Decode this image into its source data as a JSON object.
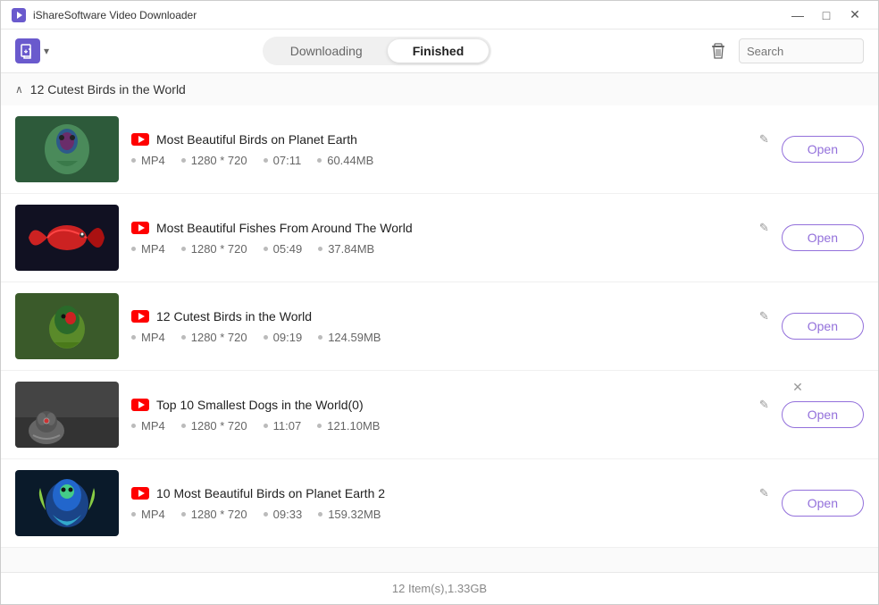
{
  "titleBar": {
    "title": "iShareSoftware Video Downloader",
    "controls": {
      "minimize": "—",
      "maximize": "□",
      "close": "✕"
    }
  },
  "toolbar": {
    "addIcon": "⬇",
    "chevron": "▾",
    "tabs": [
      {
        "id": "downloading",
        "label": "Downloading",
        "active": false
      },
      {
        "id": "finished",
        "label": "Finished",
        "active": true
      }
    ],
    "deleteIcon": "🗑",
    "searchPlaceholder": "Search"
  },
  "groupHeader": {
    "title": "12 Cutest Birds in the World",
    "collapseIcon": "∧"
  },
  "videos": [
    {
      "id": 1,
      "title": "Most Beautiful Birds on Planet Earth",
      "format": "MP4",
      "resolution": "1280 * 720",
      "duration": "07:11",
      "size": "60.44MB",
      "showClose": false,
      "thumbColors": [
        "#3a7a5a",
        "#6abf8a",
        "#8b3a5a",
        "#c04a6a"
      ]
    },
    {
      "id": 2,
      "title": "Most Beautiful Fishes From Around The World",
      "format": "MP4",
      "resolution": "1280 * 720",
      "duration": "05:49",
      "size": "37.84MB",
      "showClose": false,
      "thumbColors": [
        "#cc2222",
        "#ff4444",
        "#222244",
        "#112233"
      ]
    },
    {
      "id": 3,
      "title": "12 Cutest Birds in the World",
      "format": "MP4",
      "resolution": "1280 * 720",
      "duration": "09:19",
      "size": "124.59MB",
      "showClose": false,
      "thumbColors": [
        "#228844",
        "#44aa66",
        "#aa4422",
        "#884422"
      ]
    },
    {
      "id": 4,
      "title": "Top 10 Smallest Dogs in the World(0)",
      "format": "MP4",
      "resolution": "1280 * 720",
      "duration": "11:07",
      "size": "121.10MB",
      "showClose": true,
      "thumbColors": [
        "#555555",
        "#888888",
        "#cc3333",
        "#aaaaaa"
      ]
    },
    {
      "id": 5,
      "title": "10 Most Beautiful Birds on Planet Earth 2",
      "format": "MP4",
      "resolution": "1280 * 720",
      "duration": "09:33",
      "size": "159.32MB",
      "showClose": false,
      "thumbColors": [
        "#1144aa",
        "#2266cc",
        "#44aa88",
        "#88cc44"
      ]
    }
  ],
  "footer": {
    "summary": "12 Item(s),1.33GB"
  },
  "buttons": {
    "open": "Open"
  }
}
